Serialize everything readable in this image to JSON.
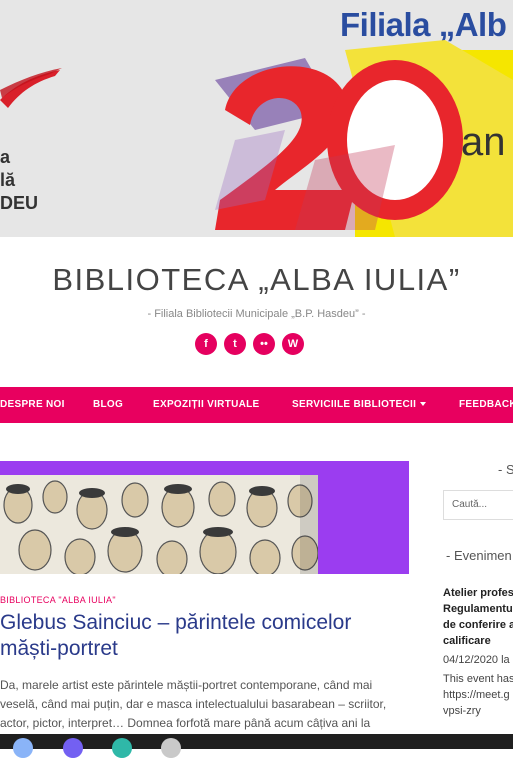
{
  "banner": {
    "filiala_text": "Filiala „Alb",
    "number": "20",
    "ani_text": "an",
    "left_lines": [
      "a",
      "lă",
      "DEU"
    ]
  },
  "site": {
    "title": "BIBLIOTECA „ALBA IULIA”",
    "description": "- Filiala Bibliotecii Municipale „B.P. Hasdeu” -"
  },
  "socials": [
    {
      "name": "facebook-icon",
      "glyph": "f"
    },
    {
      "name": "twitter-icon",
      "glyph": "t"
    },
    {
      "name": "flickr-icon",
      "glyph": "••"
    },
    {
      "name": "wordpress-icon",
      "glyph": "W"
    }
  ],
  "nav": {
    "items": [
      "DESPRE NOI",
      "BLOG",
      "EXPOZIȚII VIRTUALE",
      "SERVICIILE BIBLIOTECII",
      "FEEDBACK"
    ]
  },
  "post": {
    "category": "BIBLIOTECA \"ALBA IULIA\"",
    "title": "Glebus Sainciuc – părintele comicelor măști-portret",
    "excerpt": "Da, marele artist este părintele măștii-portret contemporane, când mai veselă, când mai puțin, dar e masca intelectualului basarabean – scriitor, actor, pictor, interpret… Domnea forfotă mare până acum câțiva ani la"
  },
  "sidebar": {
    "search_title": "- S",
    "search_placeholder": "Caută...",
    "events_title": "- Evenimen",
    "event": {
      "title": "Atelier profes Regulamentu de conferire a calificare",
      "date": "04/12/2020 la",
      "desc": "This event has https://meet.g vpsi-zry"
    }
  },
  "colors": {
    "accent": "#e8005f",
    "title_blue": "#2a3a8a",
    "feature_purple": "#9b3df0"
  }
}
